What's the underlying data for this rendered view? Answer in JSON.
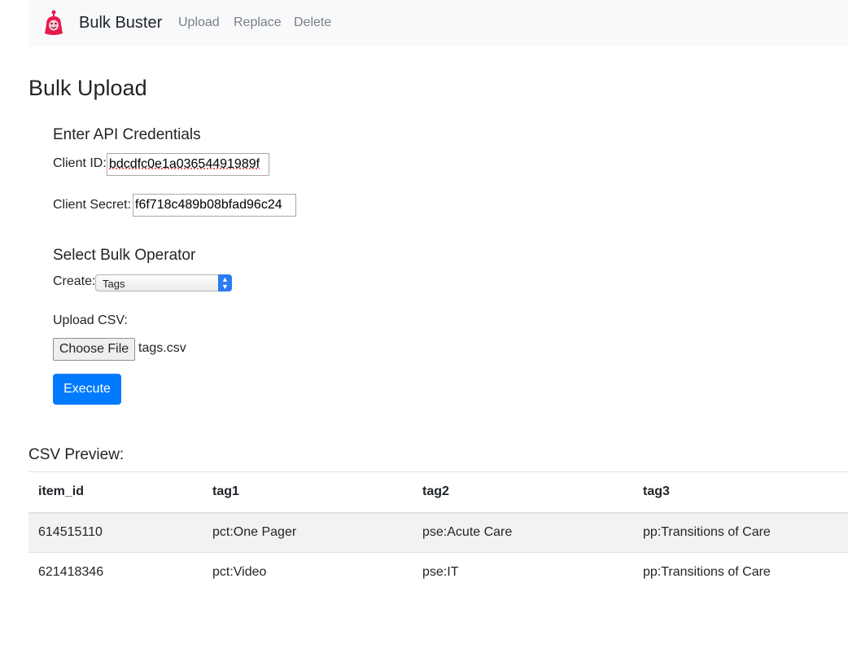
{
  "navbar": {
    "brand": "Bulk Buster",
    "links": [
      "Upload",
      "Replace",
      "Delete"
    ]
  },
  "page_title": "Bulk Upload",
  "credentials": {
    "heading": "Enter API Credentials",
    "client_id_label": "Client ID:",
    "client_id_value": "bdcdfc0e1a03654491989f",
    "client_secret_label": "Client Secret:",
    "client_secret_value": "f6f718c489b08bfad96c24"
  },
  "operator": {
    "heading": "Select Bulk Operator",
    "create_label": "Create:",
    "create_selected": "Tags",
    "upload_label": "Upload CSV:",
    "file_button": "Choose File",
    "file_name": "tags.csv",
    "execute_label": "Execute"
  },
  "preview": {
    "heading": "CSV Preview:",
    "columns": [
      "item_id",
      "tag1",
      "tag2",
      "tag3"
    ],
    "rows": [
      [
        "614515110",
        "pct:One Pager",
        "pse:Acute Care",
        "pp:Transitions of Care"
      ],
      [
        "621418346",
        "pct:Video",
        "pse:IT",
        "pp:Transitions of Care"
      ]
    ]
  },
  "colors": {
    "accent": "#007bff",
    "navbar_bg": "#f8f9fa",
    "logo": "#e8194b"
  },
  "icons": {
    "logo": "robot-icon",
    "select": "chevron-updown-icon"
  }
}
